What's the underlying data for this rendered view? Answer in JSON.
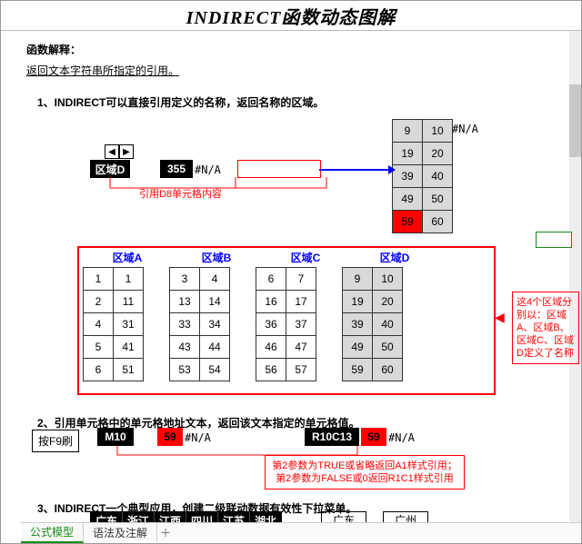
{
  "title": "INDIRECT函数动态图解",
  "explain_label": "函数解释：",
  "explain_text": "返回文本字符串所指定的引用。",
  "section1": "1、INDIRECT可以直接引用定义的名称，返回名称的区域。",
  "box1_region": "区域D",
  "box1_value": "355",
  "na": "#N/A",
  "caption1": "引用D8单元格内容",
  "range_headers": [
    "区域A",
    "区域B",
    "区域C",
    "区域D"
  ],
  "rangeA": [
    [
      "1",
      "1"
    ],
    [
      "2",
      "11"
    ],
    [
      "4",
      "31"
    ],
    [
      "5",
      "41"
    ],
    [
      "6",
      "51"
    ]
  ],
  "rangeB": [
    [
      "3",
      "4"
    ],
    [
      "13",
      "14"
    ],
    [
      "33",
      "34"
    ],
    [
      "43",
      "44"
    ],
    [
      "53",
      "54"
    ]
  ],
  "rangeC": [
    [
      "6",
      "7"
    ],
    [
      "16",
      "17"
    ],
    [
      "36",
      "37"
    ],
    [
      "46",
      "47"
    ],
    [
      "56",
      "57"
    ]
  ],
  "rangeD": [
    [
      "9",
      "10"
    ],
    [
      "19",
      "20"
    ],
    [
      "39",
      "40"
    ],
    [
      "49",
      "50"
    ],
    [
      "59",
      "60"
    ]
  ],
  "note_right": "这4个区域分别以：区域A、区域B、区域C、区域D定义了名称",
  "section2": "2、引用单元格中的单元格地址文本，返回该文本指定的单元格值。",
  "btn_f9": "按F9刷",
  "m10": "M10",
  "v59": "59",
  "r10c13": "R10C13",
  "note_param": "第2参数为TRUE或省略返回A1样式引用；\n第2参数为FALSE或0返回R1C1样式引用",
  "section3": "3、INDIRECT一个典型应用，创建二级联动数据有效性下拉菜单。",
  "provinces": [
    "广东",
    "浙江",
    "江西",
    "四川",
    "江苏",
    "湖北"
  ],
  "sel1": "广东",
  "sel2": "广州",
  "tab_active": "公式模型",
  "tab2": "语法及注解",
  "icons": {
    "left": "◀",
    "right": "▶",
    "plus": "＋",
    "arrow_left_red": "◀"
  }
}
